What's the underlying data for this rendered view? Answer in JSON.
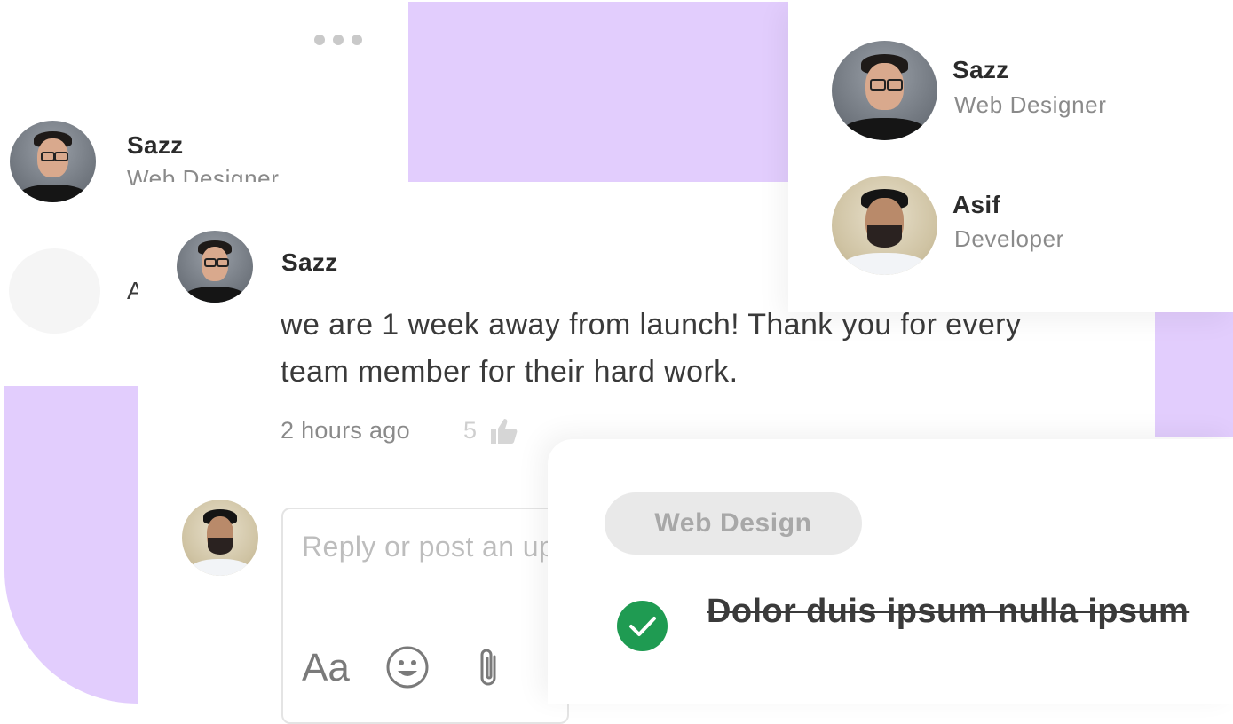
{
  "colors": {
    "accent_purple": "#e2cdfd",
    "success_green": "#1f9b52",
    "text_primary": "#2b2b2b",
    "text_secondary": "#8a8a8a"
  },
  "team_panel": {
    "members": [
      {
        "name": "Sazz",
        "role": "Web Designer"
      },
      {
        "name": "Asif",
        "role": "Developer"
      }
    ]
  },
  "background_panel": {
    "member": {
      "name": "Sazz",
      "role": "Web Designer"
    },
    "second_member_initial": "A"
  },
  "post": {
    "author": "Sazz",
    "message": "we are 1 week away from launch! Thank you for every team member for their hard work.",
    "timestamp": "2 hours ago",
    "likes": "5"
  },
  "reply": {
    "placeholder": "Reply or post an update...",
    "tools": {
      "text_format": "Aa"
    },
    "icons": [
      "emoji-icon",
      "attachment-icon"
    ]
  },
  "task_card": {
    "tag": "Web Design",
    "task": "Dolor duis ipsum nulla ipsum",
    "completed": true
  }
}
